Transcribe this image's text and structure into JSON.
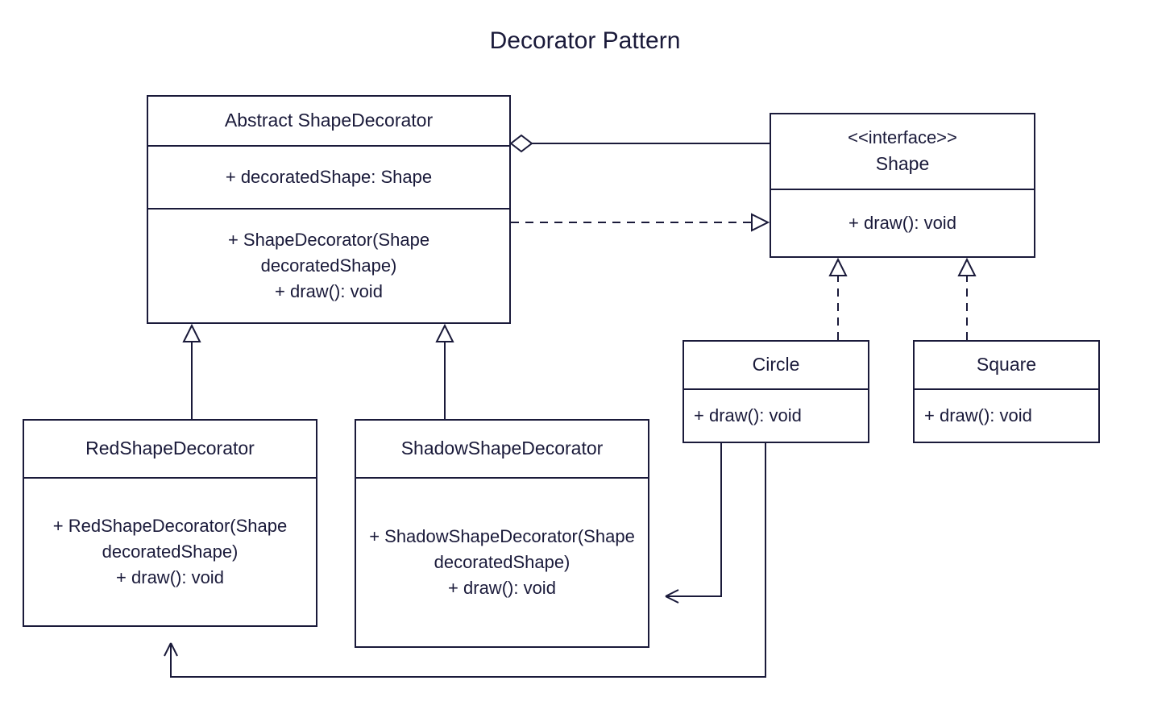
{
  "title": "Decorator Pattern",
  "classes": {
    "shapeDecorator": {
      "name": "Abstract ShapeDecorator",
      "attr": "+  decoratedShape: Shape",
      "op1": "+  ShapeDecorator(Shape decoratedShape)",
      "op2": "+   draw(): void"
    },
    "shape": {
      "stereotype": "<<interface>>",
      "name": "Shape",
      "op": "+   draw(): void"
    },
    "circle": {
      "name": "Circle",
      "op": "+   draw(): void"
    },
    "square": {
      "name": "Square",
      "op": "+   draw(): void"
    },
    "red": {
      "name": "RedShapeDecorator",
      "op1": "+ RedShapeDecorator(Shape decoratedShape)",
      "op2": "+   draw(): void"
    },
    "shadow": {
      "name": "ShadowShapeDecorator",
      "op1": "+ ShadowShapeDecorator(Shape decoratedShape)",
      "op2": "+   draw(): void"
    }
  },
  "relations": [
    {
      "from": "ShapeDecorator",
      "to": "Shape",
      "type": "aggregation"
    },
    {
      "from": "ShapeDecorator",
      "to": "Shape",
      "type": "realization"
    },
    {
      "from": "Circle",
      "to": "Shape",
      "type": "realization"
    },
    {
      "from": "Square",
      "to": "Shape",
      "type": "realization"
    },
    {
      "from": "RedShapeDecorator",
      "to": "ShapeDecorator",
      "type": "generalization"
    },
    {
      "from": "ShadowShapeDecorator",
      "to": "ShapeDecorator",
      "type": "generalization"
    },
    {
      "from": "Circle",
      "to": "RedShapeDecorator",
      "type": "association-arrow"
    },
    {
      "from": "Circle",
      "to": "ShadowShapeDecorator",
      "type": "association-arrow"
    }
  ]
}
